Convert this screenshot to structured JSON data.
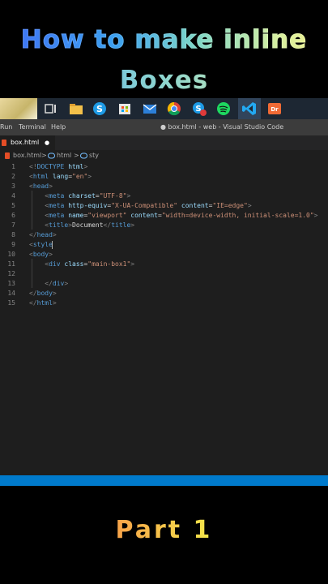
{
  "overlay": {
    "title_line1": "How to make inline",
    "title_line2": "Boxes",
    "footer": "Part 1"
  },
  "menubar": {
    "items": [
      "Run",
      "Terminal",
      "Help"
    ],
    "window_title": "● box.html - web - Visual Studio Code"
  },
  "tab": {
    "label": "box.html",
    "dirty_marker": "●"
  },
  "breadcrumb": {
    "file": "box.html",
    "sep1": ">",
    "node1": "html",
    "sep2": ">",
    "node2": "sty"
  },
  "editor": {
    "line_numbers": [
      "1",
      "2",
      "3",
      "4",
      "5",
      "6",
      "7",
      "8",
      "9",
      "10",
      "11",
      "12",
      "13",
      "14",
      "15"
    ],
    "lines": [
      "<!DOCTYPE html>",
      "<html lang=\"en\">",
      "<head>",
      "    <meta charset=\"UTF-8\">",
      "    <meta http-equiv=\"X-UA-Compatible\" content=\"IE=edge\">",
      "    <meta name=\"viewport\" content=\"width=device-width, initial-scale=1.0\">",
      "    <title>Document</title>",
      "</head>",
      "<style",
      "<body>",
      "    <div class=\"main-box1\">",
      "",
      "    </div>",
      "</body>",
      "</html>"
    ]
  },
  "taskbar": {
    "icons": [
      "wallpaper-thumbnail",
      "task-view-icon",
      "file-explorer-icon",
      "skype-icon",
      "store-icon",
      "mail-icon",
      "chrome-icon",
      "skype-notify-icon",
      "spotify-icon",
      "vscode-icon",
      "app-icon"
    ]
  },
  "colors": {
    "editor_bg": "#1e1e1e",
    "statusbar": "#007acc",
    "tag": "#569cd6",
    "attr": "#9cdcfe",
    "string": "#ce9178",
    "bracket": "#808080"
  }
}
